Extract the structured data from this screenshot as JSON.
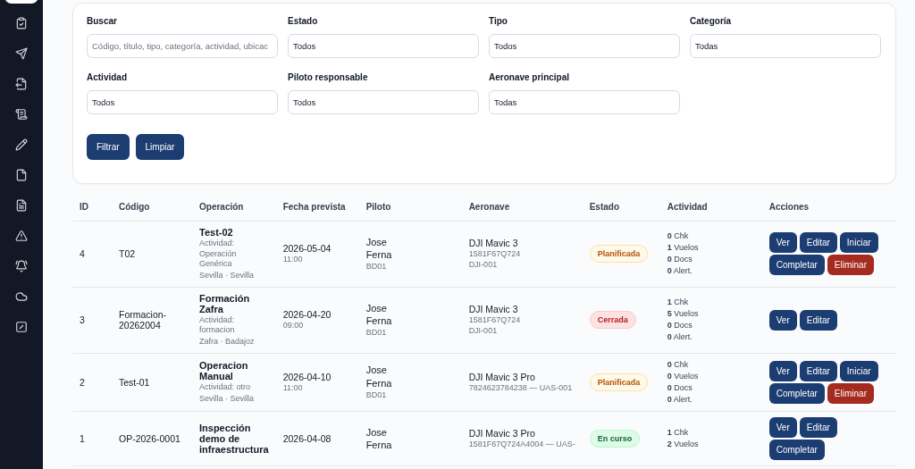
{
  "sidebar": {
    "items": [
      {
        "selected": true
      },
      {
        "selected": false
      },
      {
        "selected": false
      },
      {
        "selected": false
      },
      {
        "selected": false
      },
      {
        "selected": false
      },
      {
        "selected": false
      },
      {
        "selected": false
      },
      {
        "selected": false
      },
      {
        "selected": false
      },
      {
        "selected": false
      },
      {
        "selected": false
      }
    ]
  },
  "filters": {
    "fields": [
      {
        "label": "Buscar",
        "placeholder": "Código, título, tipo, categoría, actividad, ubicac"
      },
      {
        "label": "Estado",
        "value": "Todos"
      },
      {
        "label": "Tipo",
        "value": "Todos"
      },
      {
        "label": "Categoría",
        "value": "Todas"
      },
      {
        "label": "Actividad",
        "value": "Todos"
      },
      {
        "label": "Piloto responsable",
        "value": "Todos"
      },
      {
        "label": "Aeronave principal",
        "value": "Todas"
      }
    ],
    "buttons": [
      "Filtrar",
      "Limpiar"
    ]
  },
  "table": {
    "columns": [
      "ID",
      "Código",
      "Operación",
      "Fecha prevista",
      "Piloto",
      "Aeronave",
      "Estado",
      "Actividad",
      "Acciones"
    ],
    "rows": [
      {
        "id": "4",
        "code": "T02",
        "title": "Test-02",
        "details": [
          "Actividad: Operación Genérica",
          "Sevilla · Sevilla"
        ],
        "date": "2026-05-04",
        "time": "11:00",
        "pilot": "Jose Ferna",
        "pilot_code": "BD01",
        "aircraft": "DJI Mavic 3",
        "aircraft_details": [
          "1581F67Q724",
          "DJI-001"
        ],
        "status": {
          "kind": "planned",
          "label": "Planificada"
        },
        "activity": [
          {
            "count": "0",
            "label": "Chk"
          },
          {
            "count": "1",
            "label": "Vuelos"
          },
          {
            "count": "0",
            "label": "Docs"
          },
          {
            "count": "0",
            "label": "Alert."
          }
        ],
        "actions": [
          {
            "kind": "primary",
            "label": "Ver"
          },
          {
            "kind": "primary",
            "label": "Editar"
          },
          {
            "kind": "primary",
            "label": "Iniciar"
          },
          {
            "kind": "primary",
            "label": "Completar"
          },
          {
            "kind": "danger",
            "label": "Eliminar"
          }
        ]
      },
      {
        "id": "3",
        "code": "Formacion-20262004",
        "title": "Formación Zafra",
        "details": [
          "Actividad: formacion",
          "Zafra · Badajoz"
        ],
        "date": "2026-04-20",
        "time": "09:00",
        "pilot": "Jose Ferna",
        "pilot_code": "BD01",
        "aircraft": "DJI Mavic 3",
        "aircraft_details": [
          "1581F67Q724",
          "DJI-001"
        ],
        "status": {
          "kind": "closed",
          "label": "Cerrada"
        },
        "activity": [
          {
            "count": "1",
            "label": "Chk"
          },
          {
            "count": "5",
            "label": "Vuelos"
          },
          {
            "count": "0",
            "label": "Docs"
          },
          {
            "count": "0",
            "label": "Alert."
          }
        ],
        "actions": [
          {
            "kind": "primary",
            "label": "Ver"
          },
          {
            "kind": "primary",
            "label": "Editar"
          }
        ]
      },
      {
        "id": "2",
        "code": "Test-01",
        "title": "Operacion Manual",
        "details": [
          "Actividad: otro",
          "Sevilla · Sevilla"
        ],
        "date": "2026-04-10",
        "time": "11:00",
        "pilot": "Jose Ferna",
        "pilot_code": "BD01",
        "aircraft": "DJI Mavic 3 Pro",
        "aircraft_details": [
          "7824623784238 — UAS-001"
        ],
        "status": {
          "kind": "planned",
          "label": "Planificada"
        },
        "activity": [
          {
            "count": "0",
            "label": "Chk"
          },
          {
            "count": "0",
            "label": "Vuelos"
          },
          {
            "count": "0",
            "label": "Docs"
          },
          {
            "count": "0",
            "label": "Alert."
          }
        ],
        "actions": [
          {
            "kind": "primary",
            "label": "Ver"
          },
          {
            "kind": "primary",
            "label": "Editar"
          },
          {
            "kind": "primary",
            "label": "Iniciar"
          },
          {
            "kind": "primary",
            "label": "Completar"
          },
          {
            "kind": "danger",
            "label": "Eliminar"
          }
        ]
      },
      {
        "id": "1",
        "code": "OP-2026-0001",
        "title": "Inspección demo de infraestructura",
        "details": [],
        "date": "2026-04-08",
        "pilot": "Jose Ferna",
        "aircraft": "DJI Mavic 3 Pro",
        "aircraft_details": [
          "1581F67Q724A4004 — UAS-"
        ],
        "status": {
          "kind": "in_progress",
          "label": "En curso"
        },
        "activity": [
          {
            "count": "1",
            "label": "Chk"
          },
          {
            "count": "2",
            "label": "Vuelos"
          }
        ],
        "actions": [
          {
            "kind": "primary",
            "label": "Ver"
          },
          {
            "kind": "primary",
            "label": "Editar"
          },
          {
            "kind": "primary",
            "label": "Completar"
          }
        ]
      }
    ]
  }
}
